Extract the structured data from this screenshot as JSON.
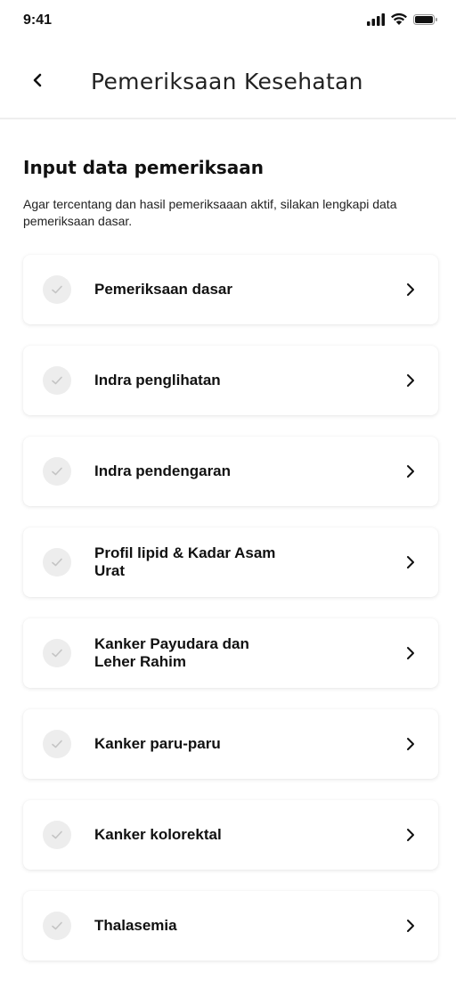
{
  "status_bar": {
    "time": "9:41",
    "icons": [
      "signal-icon",
      "wifi-icon",
      "battery-icon"
    ]
  },
  "header": {
    "back_icon": "chevron-left-icon",
    "title": "Pemeriksaan Kesehatan"
  },
  "section": {
    "heading": "Input data pemeriksaan",
    "description": "Agar tercentang dan hasil pemeriksaaan aktif, silakan lengkapi data pemeriksaan dasar."
  },
  "items": [
    {
      "label": "Pemeriksaan dasar",
      "checked": false
    },
    {
      "label": "Indra penglihatan",
      "checked": false
    },
    {
      "label": "Indra pendengaran",
      "checked": false
    },
    {
      "label": "Profil lipid & Kadar Asam Urat",
      "checked": false
    },
    {
      "label": "Kanker Payudara dan Leher Rahim",
      "checked": false
    },
    {
      "label": "Kanker paru-paru",
      "checked": false
    },
    {
      "label": "Kanker kolorektal",
      "checked": false
    },
    {
      "label": "Thalasemia",
      "checked": false
    }
  ],
  "colors": {
    "check_bg": "#ededed",
    "check_mark": "#c4c4c4",
    "divider": "#eeeeee"
  }
}
